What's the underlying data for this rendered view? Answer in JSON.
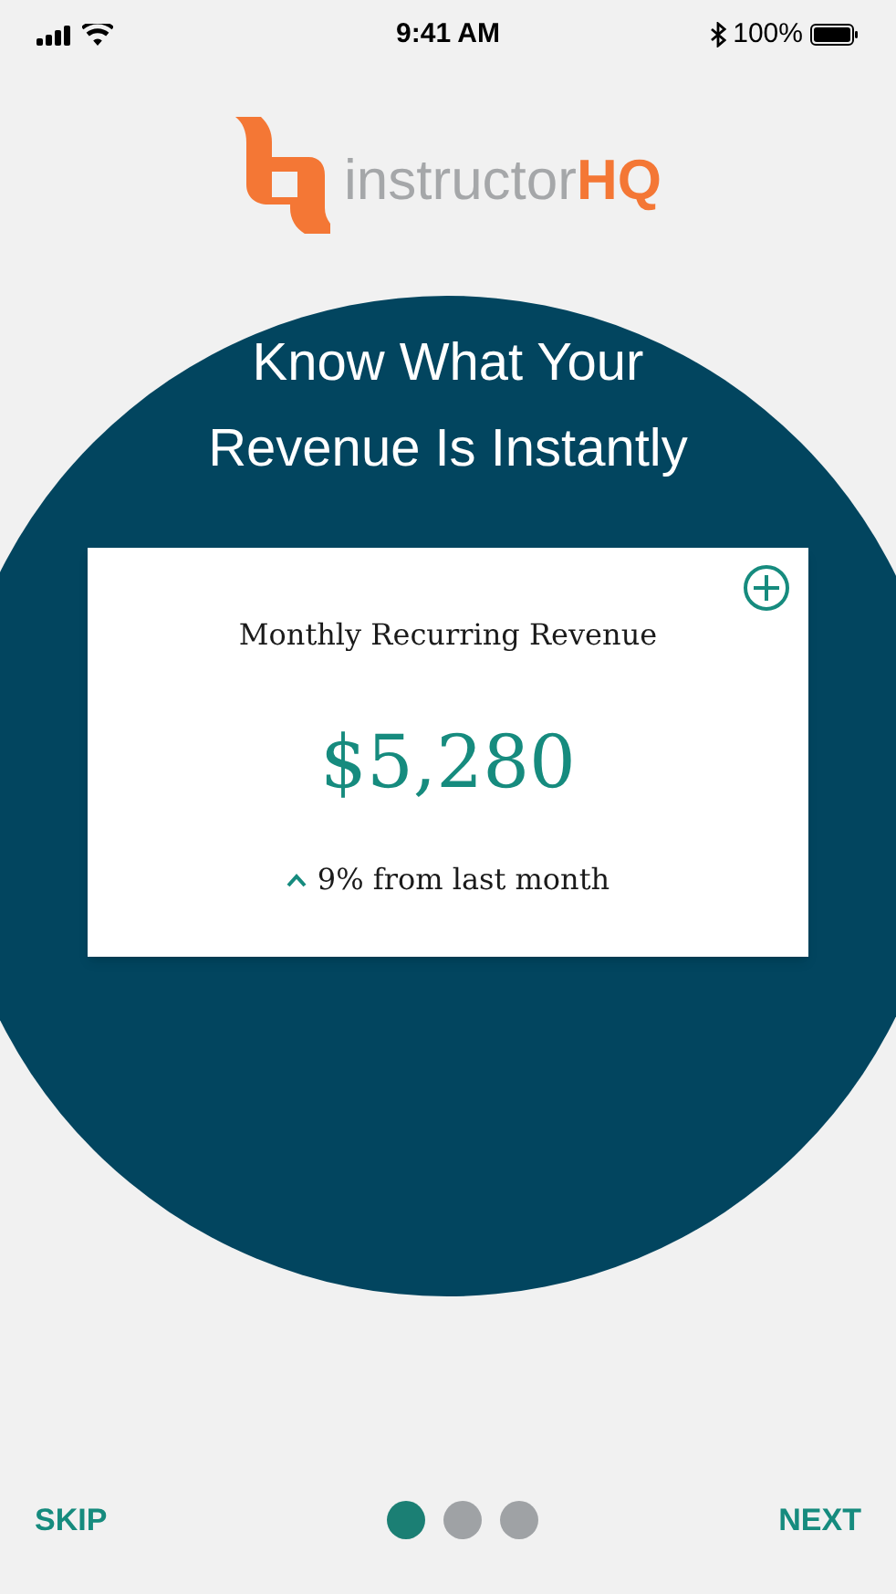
{
  "status_bar": {
    "time": "9:41 AM",
    "battery": "100%"
  },
  "logo": {
    "name": "instructor",
    "suffix": "HQ"
  },
  "title": [
    "Know What Your",
    "Revenue Is Instantly"
  ],
  "card": {
    "label": "Monthly Recurring Revenue",
    "value": "$5,280",
    "change": "9% from last month"
  },
  "footer": {
    "skip": "SKIP",
    "next": "NEXT",
    "pages": [
      {
        "selected": true
      },
      {
        "selected": false
      },
      {
        "selected": false
      }
    ]
  }
}
